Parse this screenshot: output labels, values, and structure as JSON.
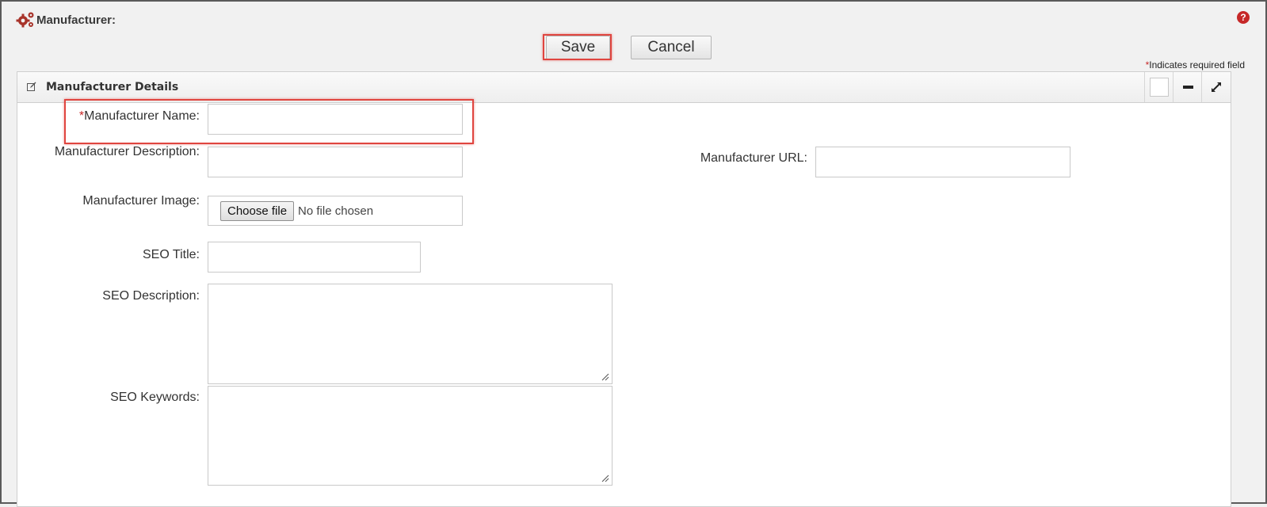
{
  "header": {
    "title": "Manufacturer:",
    "help_icon": "?"
  },
  "toolbar": {
    "save_label": "Save",
    "cancel_label": "Cancel"
  },
  "required_note": {
    "star": "*",
    "text": "Indicates required field"
  },
  "panel": {
    "title": "Manufacturer Details"
  },
  "form": {
    "manufacturer_name": {
      "star": "*",
      "label": "Manufacturer Name:",
      "value": ""
    },
    "manufacturer_description": {
      "label": "Manufacturer Description:",
      "value": ""
    },
    "manufacturer_url": {
      "label": "Manufacturer URL:",
      "value": ""
    },
    "manufacturer_image": {
      "label": "Manufacturer Image:",
      "button_label": "Choose file",
      "status": "No file chosen"
    },
    "seo_title": {
      "label": "SEO Title:",
      "value": ""
    },
    "seo_description": {
      "label": "SEO Description:",
      "value": ""
    },
    "seo_keywords": {
      "label": "SEO Keywords:",
      "value": ""
    }
  },
  "colors": {
    "accent_red": "#c62828",
    "highlight": "#e0453f"
  }
}
